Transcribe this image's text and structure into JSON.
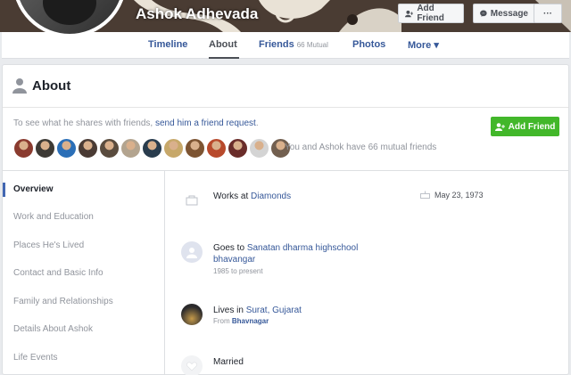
{
  "profile": {
    "name": "Ashok Adhevada",
    "add_friend_label": "Add Friend",
    "message_label": "Message",
    "more_label": "···"
  },
  "nav": {
    "timeline": "Timeline",
    "about": "About",
    "friends": "Friends",
    "friends_sub": "66 Mutual",
    "photos": "Photos",
    "more": "More ▾"
  },
  "about": {
    "title": "About",
    "prompt_prefix": "To see what he shares with friends, ",
    "prompt_link": "send him a friend request",
    "prompt_suffix": ".",
    "add_friend_label": "Add Friend",
    "mutual_text": "You and Ashok have 66 mutual friends"
  },
  "mutual_avatar_colors": [
    "#8a3b2f",
    "#3d3a35",
    "#2b6fb7",
    "#4a3b34",
    "#5a4c3e",
    "#b3a48f",
    "#293c4d",
    "#c7a86a",
    "#7d5432",
    "#b84a2c",
    "#6a2d2a",
    "#d4d4d4",
    "#725f4f"
  ],
  "sidebar": {
    "items": [
      "Overview",
      "Work and Education",
      "Places He's Lived",
      "Contact and Basic Info",
      "Family and Relationships",
      "Details About Ashok",
      "Life Events"
    ]
  },
  "content": {
    "work_prefix": "Works at ",
    "work_link": "Diamonds",
    "birthday": "May 23, 1973",
    "school_prefix": "Goes to ",
    "school_link_line1": "Sanatan dharma highschool",
    "school_link_line2": "bhavangar",
    "school_sub": "1985 to present",
    "lives_prefix": "Lives in ",
    "lives_link": "Surat, Gujarat",
    "from_prefix": "From ",
    "from_link": "Bhavnagar",
    "relationship": "Married"
  }
}
